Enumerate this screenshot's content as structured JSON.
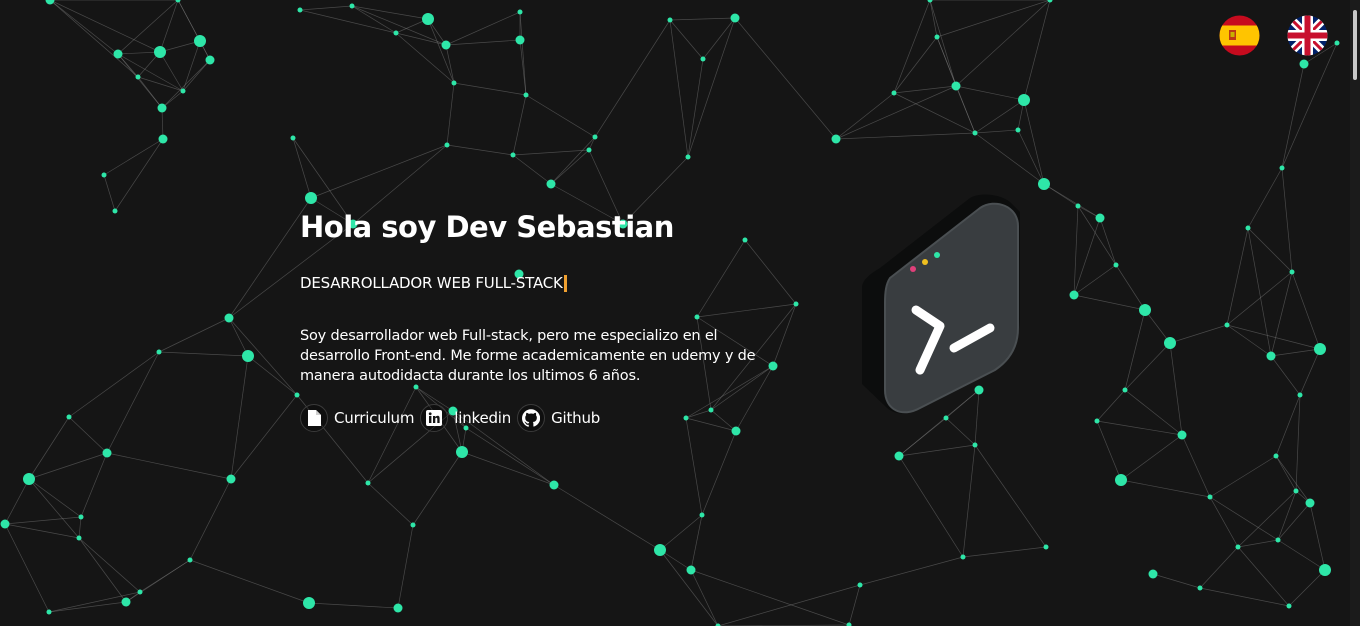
{
  "languages": [
    {
      "name": "spain-flag-icon",
      "label": "es"
    },
    {
      "name": "uk-flag-icon",
      "label": "en"
    }
  ],
  "hero": {
    "title": "Hola soy Dev Sebastian",
    "role": "DESARROLLADOR WEB FULL-STACK",
    "bio": "Soy desarrollador web Full-stack, pero me especializo en el desarrollo Front-end. Me forme academicamente en udemy y de manera autodidacta durante los ultimos 6 años."
  },
  "links": [
    {
      "label": "Curriculum",
      "icon": "file-icon"
    },
    {
      "label": "linkedin",
      "icon": "linkedin-icon"
    },
    {
      "label": "Github",
      "icon": "github-icon"
    }
  ],
  "colors": {
    "background": "#151515",
    "node": "#2ee6a8",
    "line": "#8a8a8a",
    "cursor": "#f0a030"
  },
  "illustration": {
    "icon": "terminal-icon",
    "dots": [
      "#e0407a",
      "#f0c020",
      "#2ee6a8"
    ]
  }
}
